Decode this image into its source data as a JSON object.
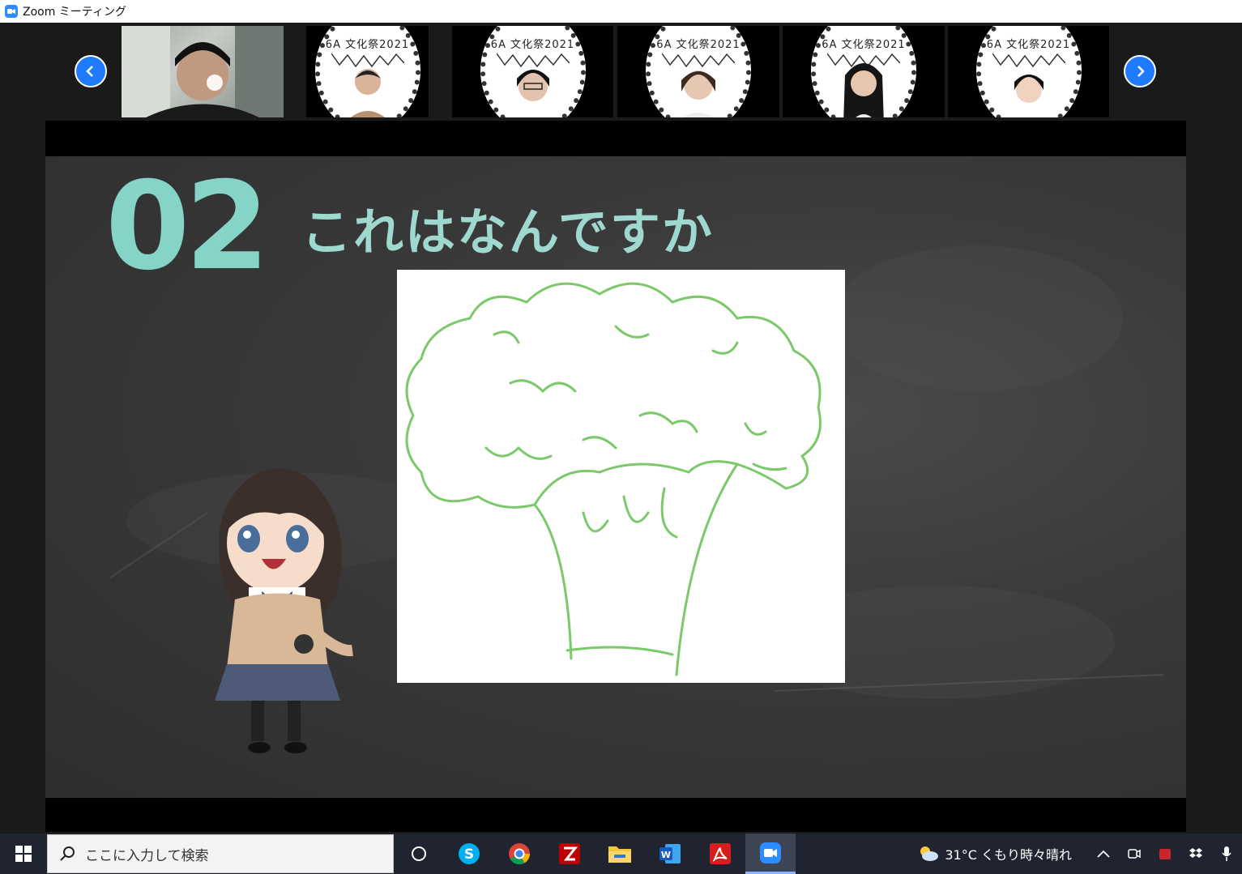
{
  "window": {
    "title": "Zoom ミーティング"
  },
  "gallery": {
    "tiles": [
      {
        "kind": "camera"
      },
      {
        "kind": "sticker",
        "label": "6A 文化祭2021"
      },
      {
        "kind": "sticker",
        "label": "6A 文化祭2021"
      },
      {
        "kind": "sticker",
        "label": "6A 文化祭2021"
      },
      {
        "kind": "sticker",
        "label": "6A 文化祭2021"
      },
      {
        "kind": "sticker",
        "label": "6A 文化祭2021"
      }
    ]
  },
  "slide": {
    "number": "02",
    "heading": "これはなんですか",
    "colors": {
      "accent": "#86d4c8",
      "board": "#3a3a3a",
      "chalk_green": "#7cc96b"
    }
  },
  "taskbar": {
    "search_placeholder": "ここに入力して検索",
    "apps": [
      "cortana-icon",
      "skype-icon",
      "chrome-icon",
      "filezilla-icon",
      "file-explorer-icon",
      "word-icon",
      "acrobat-icon",
      "zoom-icon"
    ],
    "weather": "31°C くもり時々晴れ"
  }
}
